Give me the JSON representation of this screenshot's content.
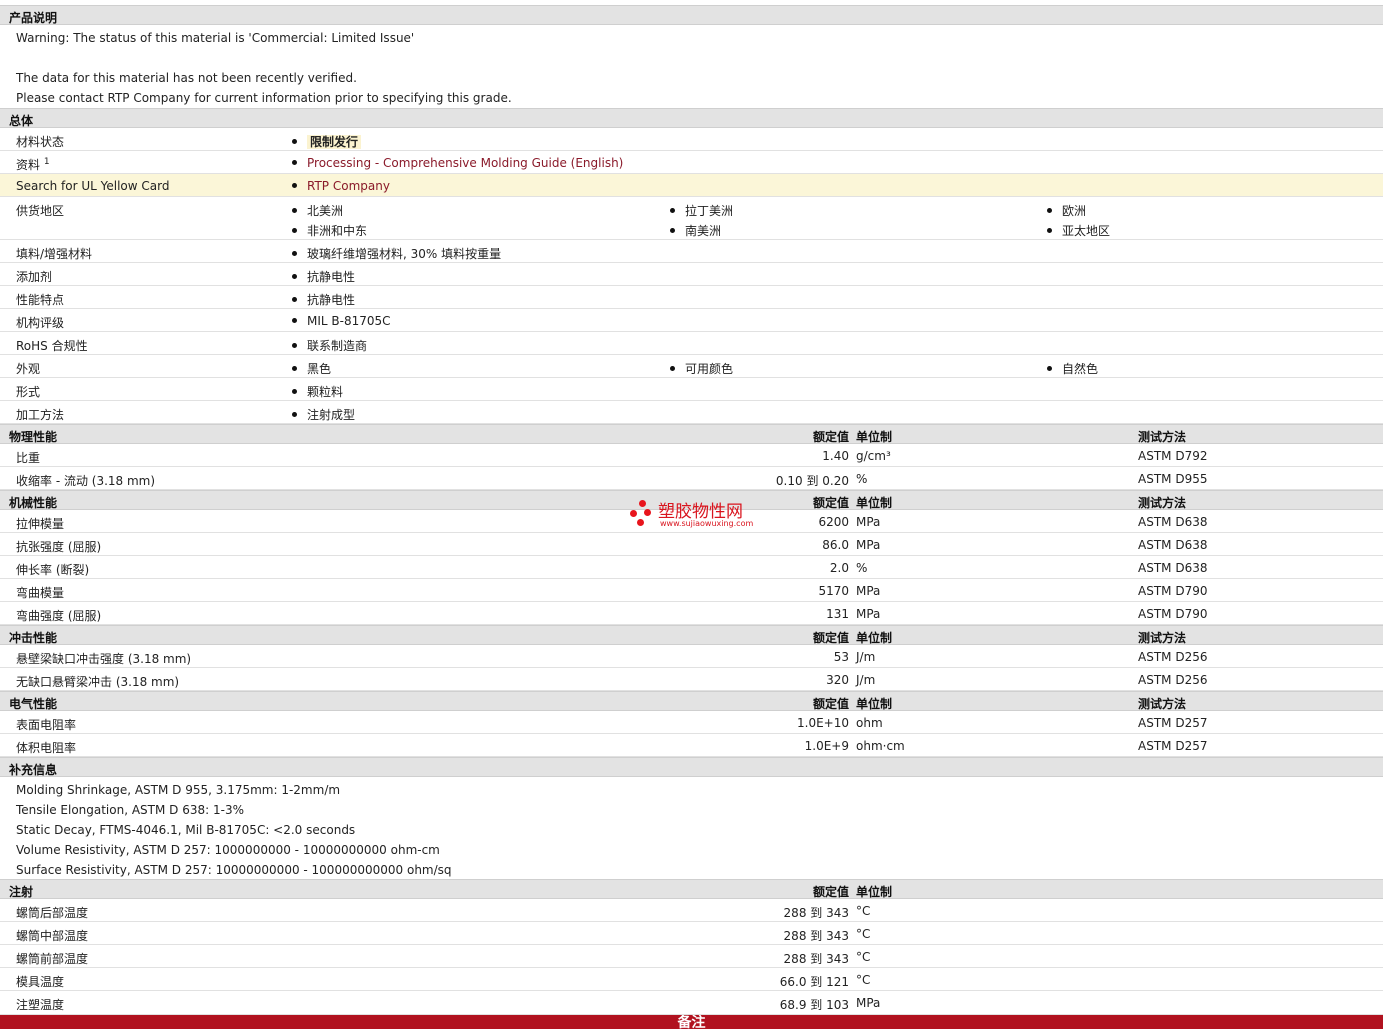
{
  "desc": {
    "title": "产品说明",
    "lines": [
      "Warning: The status of this material is 'Commercial: Limited Issue'",
      "The data for this material has not been recently verified.",
      "Please contact RTP Company for current information prior to specifying this grade."
    ]
  },
  "general": {
    "title": "总体",
    "material_status": {
      "label": "材料状态",
      "value": "限制发行"
    },
    "literature": {
      "label": "资料",
      "sup": "1",
      "value": "Processing - Comprehensive Molding Guide (English)"
    },
    "ul": {
      "label": "Search for UL Yellow Card",
      "value": "RTP Company"
    },
    "supply": {
      "label": "供货地区",
      "values": [
        "北美洲",
        "拉丁美洲",
        "欧洲",
        "非洲和中东",
        "南美洲",
        "亚太地区"
      ]
    },
    "filler": {
      "label": "填料/增强材料",
      "value": "玻璃纤维增强材料, 30% 填料按重量"
    },
    "additive": {
      "label": "添加剂",
      "value": "抗静电性"
    },
    "features": {
      "label": "性能特点",
      "value": "抗静电性"
    },
    "agency": {
      "label": "机构评级",
      "value": "MIL B-81705C"
    },
    "rohs": {
      "label": "RoHS 合规性",
      "value": "联系制造商"
    },
    "appearance": {
      "label": "外观",
      "values": [
        "黑色",
        "可用颜色",
        "自然色"
      ]
    },
    "form": {
      "label": "形式",
      "value": "颗粒料"
    },
    "processing": {
      "label": "加工方法",
      "value": "注射成型"
    }
  },
  "headers": {
    "nominal": "额定值",
    "unit": "单位制",
    "method": "测试方法"
  },
  "physical": {
    "title": "物理性能",
    "rows": [
      {
        "label": "比重",
        "value": "1.40",
        "unit": "g/cm³",
        "method": "ASTM D792"
      },
      {
        "label": "收缩率 - 流动  (3.18 mm)",
        "value": "0.10 到  0.20",
        "unit": "%",
        "method": "ASTM D955"
      }
    ]
  },
  "mechanical": {
    "title": "机械性能",
    "rows": [
      {
        "label": "拉伸模量",
        "value": "6200",
        "unit": "MPa",
        "method": "ASTM D638"
      },
      {
        "label": "抗张强度  (屈服)",
        "value": "86.0",
        "unit": "MPa",
        "method": "ASTM D638"
      },
      {
        "label": "伸长率  (断裂)",
        "value": "2.0",
        "unit": "%",
        "method": "ASTM D638"
      },
      {
        "label": "弯曲模量",
        "value": "5170",
        "unit": "MPa",
        "method": "ASTM D790"
      },
      {
        "label": "弯曲强度  (屈服)",
        "value": "131",
        "unit": "MPa",
        "method": "ASTM D790"
      }
    ]
  },
  "impact": {
    "title": "冲击性能",
    "rows": [
      {
        "label": "悬壁梁缺口冲击强度  (3.18 mm)",
        "value": "53",
        "unit": "J/m",
        "method": "ASTM D256"
      },
      {
        "label": "无缺口悬臂梁冲击  (3.18 mm)",
        "value": "320",
        "unit": "J/m",
        "method": "ASTM D256"
      }
    ]
  },
  "electrical": {
    "title": "电气性能",
    "rows": [
      {
        "label": "表面电阻率",
        "value": "1.0E+10",
        "unit": "ohm",
        "method": "ASTM D257"
      },
      {
        "label": "体积电阻率",
        "value": "1.0E+9",
        "unit": "ohm·cm",
        "method": "ASTM D257"
      }
    ]
  },
  "supplement": {
    "title": "补充信息",
    "lines": [
      "Molding Shrinkage, ASTM D 955, 3.175mm: 1-2mm/m",
      "Tensile Elongation, ASTM D 638: 1-3%",
      "Static Decay, FTMS-4046.1, Mil B-81705C: <2.0 seconds",
      "Volume Resistivity, ASTM D 257: 1000000000 - 10000000000 ohm-cm",
      "Surface Resistivity, ASTM D 257: 10000000000 - 100000000000 ohm/sq"
    ]
  },
  "injection": {
    "title": "注射",
    "rows": [
      {
        "label": "螺筒后部温度",
        "value": "288 到  343",
        "unit": "°C"
      },
      {
        "label": "螺筒中部温度",
        "value": "288 到  343",
        "unit": "°C"
      },
      {
        "label": "螺筒前部温度",
        "value": "288 到  343",
        "unit": "°C"
      },
      {
        "label": "模具温度",
        "value": "66.0 到  121",
        "unit": "°C"
      },
      {
        "label": "注塑温度",
        "value": "68.9 到  103",
        "unit": "MPa"
      }
    ]
  },
  "footer": {
    "label": "备注"
  },
  "watermark": {
    "name": "塑胶物性网",
    "url": "www.sujiaowuxing.com"
  }
}
